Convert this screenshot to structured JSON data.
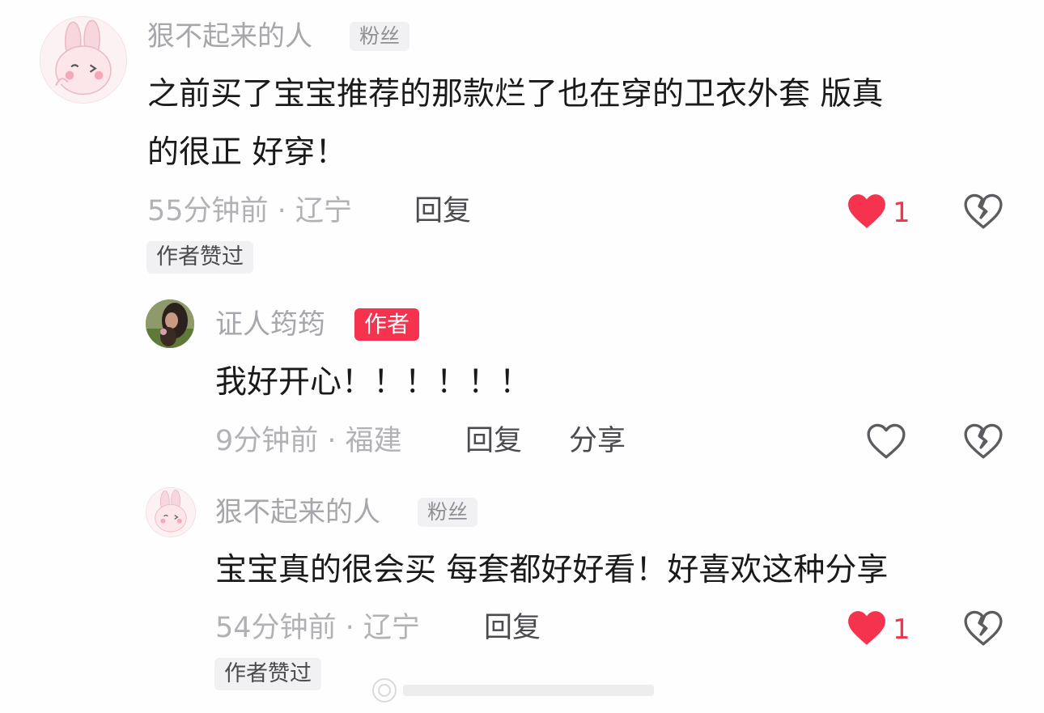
{
  "comments": [
    {
      "username": "狠不起来的人",
      "badge": "粉丝",
      "text_line1": "之前买了宝宝推荐的那款烂了也在穿的卫衣外套 版真",
      "text_line2": "的很正 好穿！",
      "time_location": "55分钟前 · 辽宁",
      "reply_label": "回复",
      "like_count": "1",
      "author_liked": "作者赞过",
      "avatar_icon": "bunny-avatar-icon"
    },
    {
      "username": "证人筠筠",
      "badge": "作者",
      "text": "我好开心！！！！！！",
      "time_location": "9分钟前 · 福建",
      "reply_label": "回复",
      "share_label": "分享",
      "avatar_icon": "photo-avatar-icon"
    },
    {
      "username": "狠不起来的人",
      "badge": "粉丝",
      "text": "宝宝真的很会买 每套都好好看！好喜欢这种分享",
      "time_location": "54分钟前 · 辽宁",
      "reply_label": "回复",
      "like_count": "1",
      "author_liked": "作者赞过",
      "avatar_icon": "bunny-avatar-icon"
    }
  ],
  "colors": {
    "liked_heart": "#f5334f",
    "author_badge": "#f5334f",
    "muted_text": "#b2b2b6",
    "body_text": "#1a1a1a"
  }
}
